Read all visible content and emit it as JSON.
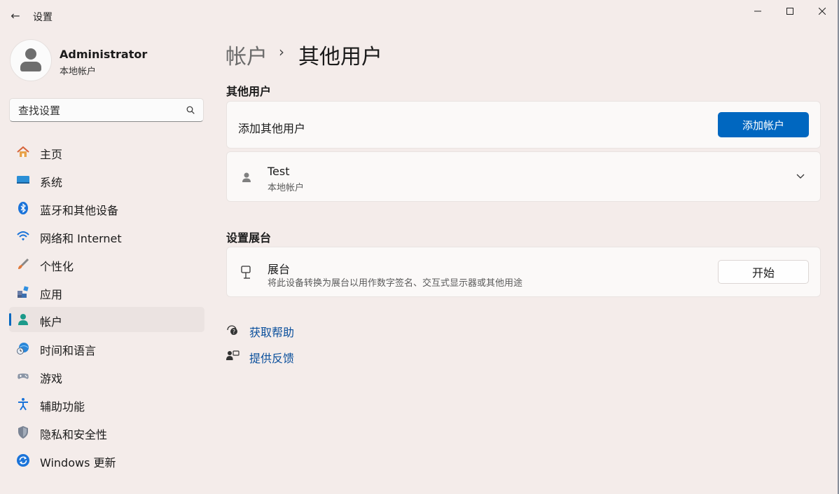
{
  "titlebar": {
    "title": "设置",
    "back_glyph": "←",
    "minimize_glyph": "—",
    "maximize_glyph": "☐",
    "close_glyph": "✕"
  },
  "profile": {
    "name": "Administrator",
    "account_type": "本地帐户"
  },
  "search": {
    "placeholder": "查找设置"
  },
  "nav": {
    "items": [
      {
        "label": "主页",
        "icon": "home-icon"
      },
      {
        "label": "系统",
        "icon": "system-icon"
      },
      {
        "label": "蓝牙和其他设备",
        "icon": "bluetooth-icon"
      },
      {
        "label": "网络和 Internet",
        "icon": "wifi-icon"
      },
      {
        "label": "个性化",
        "icon": "brush-icon"
      },
      {
        "label": "应用",
        "icon": "apps-icon"
      },
      {
        "label": "帐户",
        "icon": "accounts-icon",
        "selected": true
      },
      {
        "label": "时间和语言",
        "icon": "time-language-icon"
      },
      {
        "label": "游戏",
        "icon": "gamepad-icon"
      },
      {
        "label": "辅助功能",
        "icon": "accessibility-icon"
      },
      {
        "label": "隐私和安全性",
        "icon": "shield-icon"
      },
      {
        "label": "Windows 更新",
        "icon": "windows-update-icon"
      }
    ]
  },
  "breadcrumb": {
    "parent": "帐户",
    "separator": "›",
    "current": "其他用户"
  },
  "other_users": {
    "section_title": "其他用户",
    "add_row_label": "添加其他用户",
    "add_button": "添加帐户",
    "users": [
      {
        "name": "Test",
        "type": "本地帐户"
      }
    ]
  },
  "kiosk": {
    "section_title": "设置展台",
    "title": "展台",
    "description": "将此设备转换为展台以用作数字签名、交互式显示器或其他用途",
    "button": "开始"
  },
  "links": {
    "help": "获取帮助",
    "feedback": "提供反馈"
  },
  "colors": {
    "accent": "#0067c0",
    "background": "#f4ecea",
    "card": "#fbf9f8",
    "link": "#0a4f9c"
  }
}
